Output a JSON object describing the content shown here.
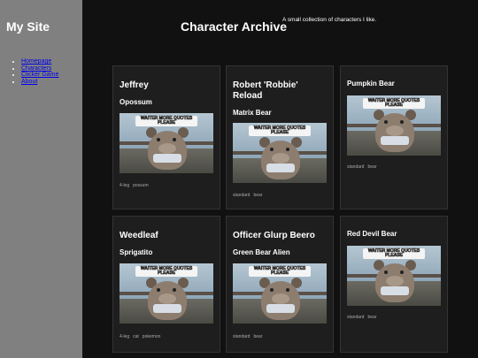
{
  "sidebar": {
    "site_title": "My Site",
    "nav": [
      {
        "label": "Homepage"
      },
      {
        "label": "Characters"
      },
      {
        "label": "Clicker Game"
      },
      {
        "label": "About"
      }
    ]
  },
  "header": {
    "title": "Character Archive",
    "subtitle": "A small collection of characters I like."
  },
  "image_caption": "WAITER MORE QUOTES PLEASE",
  "cards": [
    {
      "name": "Jeffrey",
      "type": "Opossum",
      "tags": [
        "4-leg",
        "possum"
      ]
    },
    {
      "name": "Robert 'Robbie' Reload",
      "type": "Matrix Bear",
      "tags": [
        "standard",
        "bear"
      ]
    },
    {
      "name": "Pumpkin Bear",
      "type": "",
      "tags": [
        "standard",
        "bear"
      ]
    },
    {
      "name": "Weedleaf",
      "type": "Sprigatito",
      "tags": [
        "4-leg",
        "cat",
        "pokemon"
      ]
    },
    {
      "name": "Officer Glurp Beero",
      "type": "Green Bear Alien",
      "tags": [
        "standard",
        "bear"
      ]
    },
    {
      "name": "Red Devil Bear",
      "type": "",
      "tags": [
        "standard",
        "bear"
      ]
    }
  ],
  "colors": {
    "sidebar_bg": "#808080",
    "main_bg": "#111111",
    "card_bg": "#1e1e1e",
    "link": "#0000ee"
  }
}
